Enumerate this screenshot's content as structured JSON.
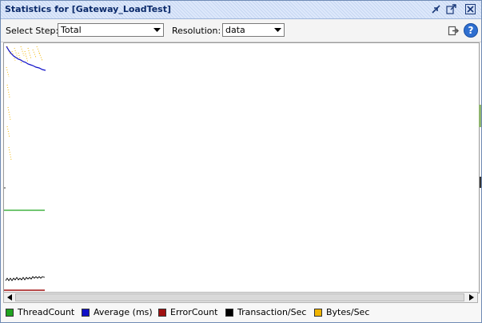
{
  "window": {
    "title": "Statistics for [Gateway_LoadTest]"
  },
  "toolbar": {
    "select_step_label": "Select Step:",
    "select_step_value": "Total",
    "resolution_label": "Resolution:",
    "resolution_value": "data"
  },
  "icons": {
    "minimize": "minimize-icon",
    "restore": "restore-icon",
    "close": "close-icon",
    "export": "export-icon",
    "help": "help-icon"
  },
  "help_symbol": "?",
  "legend": [
    {
      "label": "ThreadCount",
      "color": "#1fa31f"
    },
    {
      "label": "Average (ms)",
      "color": "#1010c8"
    },
    {
      "label": "ErrorCount",
      "color": "#a01010"
    },
    {
      "label": "Transaction/Sec",
      "color": "#000000"
    },
    {
      "label": "Bytes/Sec",
      "color": "#f0b400"
    }
  ]
}
